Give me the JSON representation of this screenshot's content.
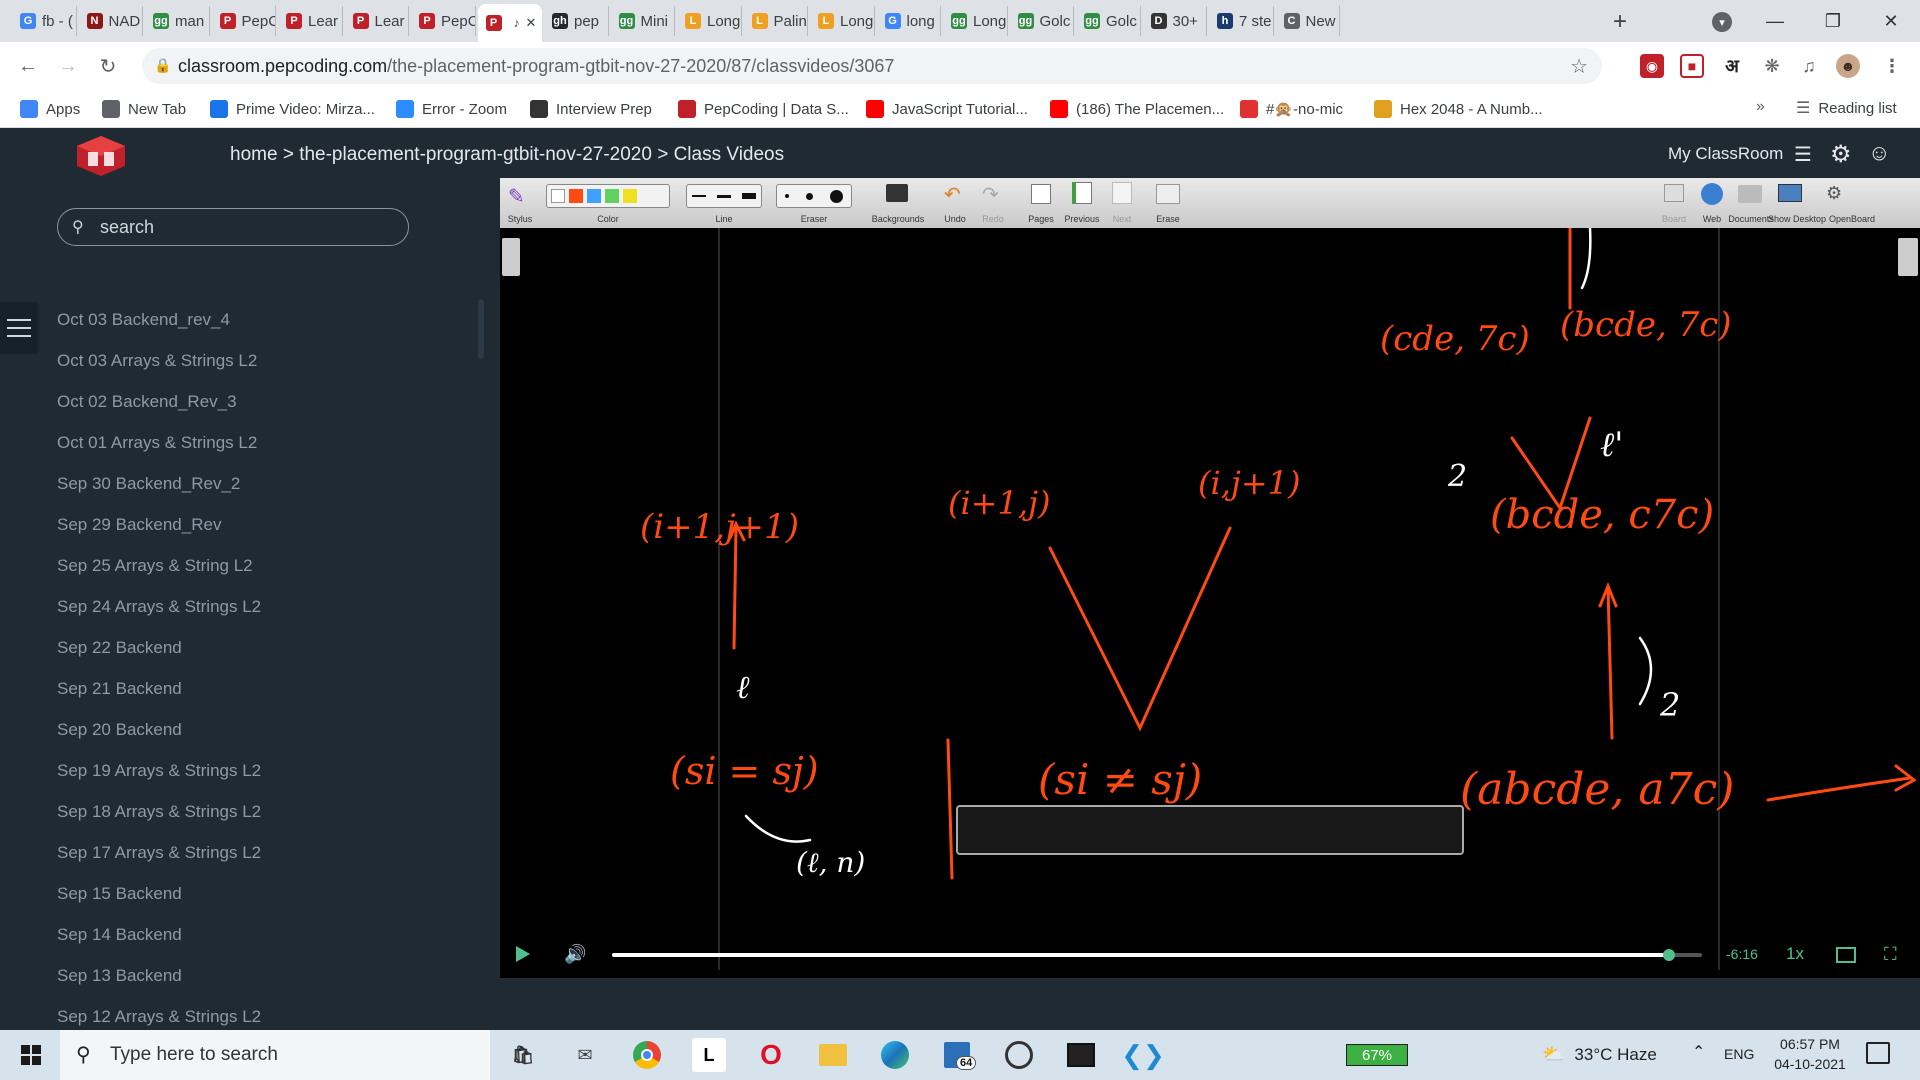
{
  "tabs": [
    {
      "label": "fb - (",
      "icon": "G",
      "color": "#4285f4"
    },
    {
      "label": "NAD",
      "icon": "N",
      "color": "#8a1a1a"
    },
    {
      "label": "man",
      "icon": "gg",
      "color": "#2f8d46"
    },
    {
      "label": "PepC",
      "icon": "P",
      "color": "#c0202a"
    },
    {
      "label": "Lear",
      "icon": "P",
      "color": "#c0202a"
    },
    {
      "label": "Lear",
      "icon": "P",
      "color": "#c0202a"
    },
    {
      "label": "PepC",
      "icon": "P",
      "color": "#c0202a"
    },
    {
      "label": "",
      "icon": "P",
      "color": "#c0202a",
      "active": true
    },
    {
      "label": "pep",
      "icon": "gh",
      "color": "#24292e"
    },
    {
      "label": "Mini",
      "icon": "gg",
      "color": "#2f8d46"
    },
    {
      "label": "Long",
      "icon": "L",
      "color": "#f0a020"
    },
    {
      "label": "Palin",
      "icon": "L",
      "color": "#f0a020"
    },
    {
      "label": "Long",
      "icon": "L",
      "color": "#f0a020"
    },
    {
      "label": "long",
      "icon": "G",
      "color": "#4285f4"
    },
    {
      "label": "Long",
      "icon": "gg",
      "color": "#2f8d46"
    },
    {
      "label": "Golc",
      "icon": "gg",
      "color": "#2f8d46"
    },
    {
      "label": "Golc",
      "icon": "gg",
      "color": "#2f8d46"
    },
    {
      "label": "30+",
      "icon": "D",
      "color": "#333333"
    },
    {
      "label": "7 ste",
      "icon": "h",
      "color": "#1c3a6e"
    },
    {
      "label": "New",
      "icon": "C",
      "color": "#5f6368"
    }
  ],
  "address": {
    "host": "classroom.pepcoding.com",
    "path": "/the-placement-program-gtbit-nov-27-2020/87/classvideos/3067"
  },
  "bookmarks": [
    {
      "label": "Apps",
      "color": "#4285f4"
    },
    {
      "label": "New Tab",
      "color": "#5f6368"
    },
    {
      "label": "Prime Video: Mirza...",
      "color": "#1a73e8"
    },
    {
      "label": "Error - Zoom",
      "color": "#2d8cff"
    },
    {
      "label": "Interview Prep",
      "color": "#333333"
    },
    {
      "label": "PepCoding | Data S...",
      "color": "#c0202a"
    },
    {
      "label": "JavaScript Tutorial...",
      "color": "#ff0000"
    },
    {
      "label": "(186) The Placemen...",
      "color": "#ff0000"
    },
    {
      "label": "#🙊-no-mic",
      "color": "#e03030"
    },
    {
      "label": "Hex 2048 - A Numb...",
      "color": "#e0a020"
    }
  ],
  "bookmarks_more": "»",
  "reading_list": "Reading list",
  "site": {
    "crumb_home": "home",
    "crumb_course": "the-placement-program-gtbit-nov-27-2020",
    "crumb_page": "Class Videos",
    "my_classroom": "My ClassRoom"
  },
  "sidebar": {
    "search_placeholder": "search",
    "items": [
      "Oct 03 Backend_rev_4",
      "Oct 03 Arrays & Strings L2",
      "Oct 02 Backend_Rev_3",
      "Oct 01 Arrays & Strings L2",
      "Sep 30 Backend_Rev_2",
      "Sep 29 Backend_Rev",
      "Sep 25 Arrays & String L2",
      "Sep 24 Arrays & Strings L2",
      "Sep 22 Backend",
      "Sep 21 Backend",
      "Sep 20 Backend",
      "Sep 19 Arrays & Strings L2",
      "Sep 18 Arrays & Strings L2",
      "Sep 17 Arrays & Strings L2",
      "Sep 15 Backend",
      "Sep 14 Backend",
      "Sep 13 Backend",
      "Sep 12 Arrays & Strings L2"
    ]
  },
  "openboard": {
    "labels": [
      "Stylus",
      "Color",
      "Line",
      "Eraser",
      "Backgrounds",
      "Undo",
      "Redo",
      "Pages",
      "Previous",
      "Next",
      "Erase"
    ],
    "right_labels": [
      "Board",
      "Web",
      "Documents",
      "Show Desktop",
      "OpenBoard"
    ]
  },
  "whiteboard": {
    "notes": [
      "(i+1,j+1)",
      "(i+1,j)",
      "(i,j+1)",
      "(si = sj)",
      "(si ≠ sj)",
      "(cde, 7c)",
      "(bcde, 7c)",
      "(bcde, c7c)",
      "(abcde, a7c)",
      "ℓ",
      "2",
      "ℓ'",
      "(ℓ, n)"
    ]
  },
  "player": {
    "time": "-6:16",
    "speed": "1x",
    "progress": 0.97
  },
  "taskbar": {
    "search_placeholder": "Type here to search",
    "battery": "67%",
    "weather": "33°C  Haze",
    "lang": "ENG",
    "time": "06:57 PM",
    "date": "04-10-2021",
    "badge_64": "64"
  },
  "colors": {
    "ink_orange": "#ff4a12",
    "ink_white": "#ffffff",
    "site_bg": "#1f2a33",
    "sidebar_text": "#8e9aa4"
  }
}
